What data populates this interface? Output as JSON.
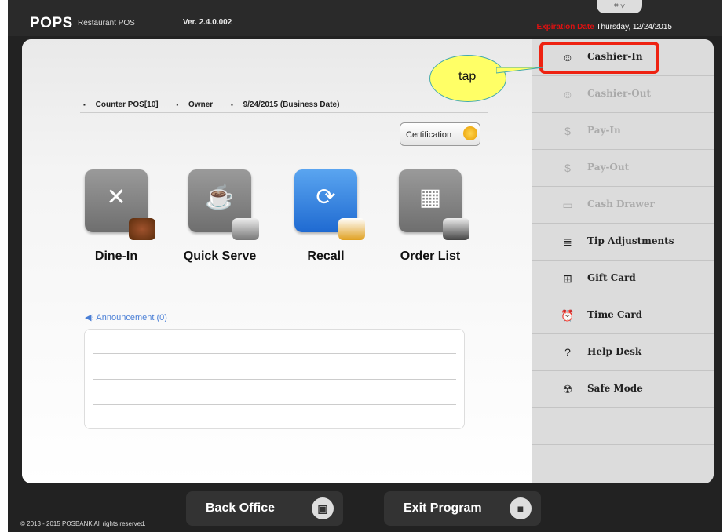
{
  "header": {
    "logo": "POPS",
    "logo_sub": "Restaurant POS",
    "version": "Ver. 2.4.0.002",
    "window_controls": "⌗ ∨",
    "expiration_label": "Expiration Date",
    "expiration_date": "Thursday, 12/24/2015"
  },
  "context": {
    "terminal": "Counter POS[10]",
    "role": "Owner",
    "business_date": "9/24/2015 (Business Date)"
  },
  "certification_label": "Certification",
  "tiles": [
    {
      "label": "Dine-In",
      "icon": "fork-knife-icon"
    },
    {
      "label": "Quick Serve",
      "icon": "cup-icon"
    },
    {
      "label": "Recall",
      "icon": "recall-icon"
    },
    {
      "label": "Order List",
      "icon": "calculator-icon"
    }
  ],
  "announcement": {
    "label": "Announcement (0)"
  },
  "side_menu": [
    {
      "label": "Cashier-In",
      "icon": "cashier-in-icon",
      "enabled": true
    },
    {
      "label": "Cashier-Out",
      "icon": "cashier-out-icon",
      "enabled": false
    },
    {
      "label": "Pay-In",
      "icon": "pay-in-icon",
      "enabled": false
    },
    {
      "label": "Pay-Out",
      "icon": "pay-out-icon",
      "enabled": false
    },
    {
      "label": "Cash Drawer",
      "icon": "cash-drawer-icon",
      "enabled": false
    },
    {
      "label": "Tip Adjustments",
      "icon": "tip-icon",
      "enabled": true
    },
    {
      "label": "Gift Card",
      "icon": "gift-icon",
      "enabled": true
    },
    {
      "label": "Time Card",
      "icon": "alarm-clock-icon",
      "enabled": true
    },
    {
      "label": "Help Desk",
      "icon": "help-icon",
      "enabled": true
    },
    {
      "label": "Safe Mode",
      "icon": "siren-icon",
      "enabled": true
    }
  ],
  "callout": {
    "text": "tap"
  },
  "bottom": {
    "back_office": "Back Office",
    "exit_program": "Exit Program",
    "copyright": "© 2013 - 2015 POSBANK All rights reserved."
  },
  "colors": {
    "highlight": "#e21111",
    "callout_fill": "#ffff66",
    "recall_blue": "#1f6ad1",
    "expiry_red": "#d11111"
  }
}
